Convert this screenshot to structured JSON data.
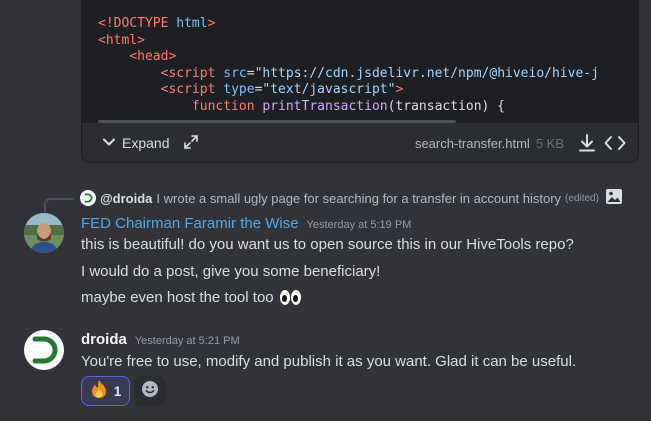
{
  "attachment": {
    "code_lines": [
      [
        {
          "t": "<!DOCTYPE ",
          "c": "tk-tag"
        },
        {
          "t": "html",
          "c": "tk-attr"
        },
        {
          "t": ">",
          "c": "tk-tag"
        }
      ],
      [
        {
          "t": "<html>",
          "c": "tk-tag"
        }
      ],
      [
        {
          "t": "    "
        },
        {
          "t": "<head>",
          "c": "tk-tag"
        }
      ],
      [
        {
          "t": "        "
        },
        {
          "t": "<script ",
          "c": "tk-tag"
        },
        {
          "t": "src",
          "c": "tk-attr"
        },
        {
          "t": "="
        },
        {
          "t": "\"https://cdn.jsdelivr.net/npm/@hiveio/hive-j",
          "c": "tk-str"
        }
      ],
      [
        {
          "t": "        "
        },
        {
          "t": "<script ",
          "c": "tk-tag"
        },
        {
          "t": "type",
          "c": "tk-attr"
        },
        {
          "t": "="
        },
        {
          "t": "\"text/javascript\"",
          "c": "tk-str"
        },
        {
          "t": ">",
          "c": "tk-tag"
        }
      ],
      [
        {
          "t": "            "
        },
        {
          "t": "function ",
          "c": "tk-kw"
        },
        {
          "t": "printTransaction",
          "c": "tk-fn"
        },
        {
          "t": "(transaction) {"
        }
      ]
    ],
    "expand_label": "Expand",
    "file_name": "search-transfer.html",
    "file_size": "5 KB"
  },
  "reply": {
    "author": "@droida",
    "text": "I wrote a small ugly page for searching for a transfer in account history",
    "edited": "(edited)"
  },
  "messages": [
    {
      "author": "FED Chairman Faramir the Wise",
      "timestamp": "Yesterday at 5:19 PM",
      "lines": [
        "this is beautiful!  do you want us to open source this in our HiveTools repo?",
        "I would do a post, give you some beneficiary!",
        "maybe even host the tool too"
      ]
    },
    {
      "author": "droida",
      "timestamp": "Yesterday at 5:21 PM",
      "lines": [
        "You're free to use, modify and publish it as you want. Glad it can be useful."
      ]
    }
  ],
  "reactions": [
    {
      "emoji": "fire",
      "count": "1"
    }
  ],
  "colors": {
    "background": "#323339",
    "code_bg": "#1e1f22",
    "username_blue": "#52a8e8",
    "reaction_border": "#5865f2",
    "droida_green": "#1f7a2b"
  }
}
